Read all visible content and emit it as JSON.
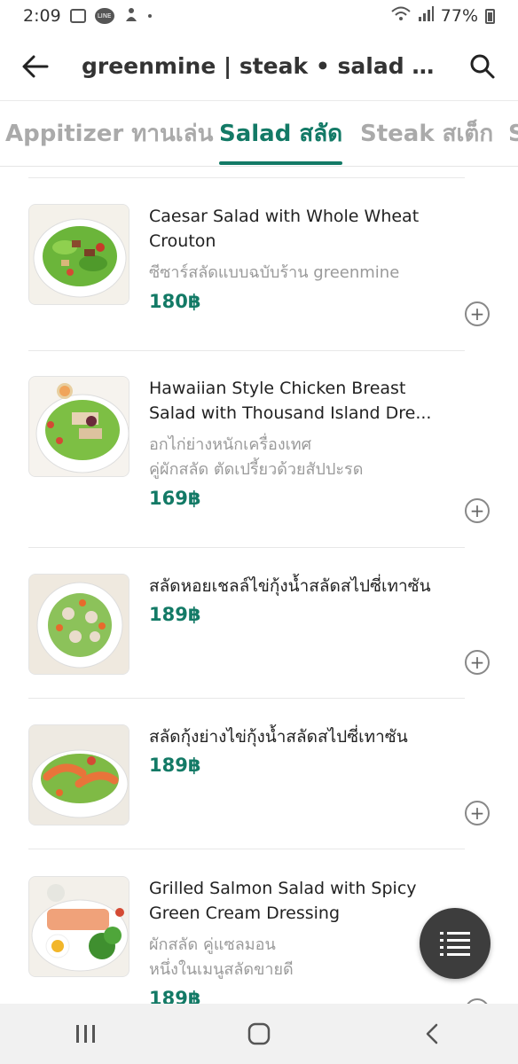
{
  "status_bar": {
    "time": "2:09",
    "battery_text": "77%",
    "line_badge": "LINE"
  },
  "header": {
    "title": "greenmine | steak • salad • coff…"
  },
  "tabs": [
    {
      "label": "Appitizer ทานเล่น",
      "active": false
    },
    {
      "label": "Salad สลัด",
      "active": true
    },
    {
      "label": "Steak สเต็ก",
      "active": false
    },
    {
      "label": "S",
      "active": false
    }
  ],
  "colors": {
    "accent": "#137a66",
    "fab": "#3d3d3d"
  },
  "menu_items": [
    {
      "name_lines": [
        "Caesar Salad with Whole Wheat",
        "Crouton"
      ],
      "desc_lines": [
        "ซีซาร์สลัดแบบฉบับร้าน greenmine"
      ],
      "price": "180฿",
      "image": "caesar-salad-image"
    },
    {
      "name_lines": [
        "Hawaiian Style Chicken Breast",
        "Salad with Thousand Island Dre..."
      ],
      "desc_lines": [
        "อกไก่ย่างหนักเครื่องเทศ",
        "คู่ผักสลัด ตัดเปรี้ยวด้วยสัปปะรด"
      ],
      "price": "169฿",
      "image": "chicken-salad-image"
    },
    {
      "name_lines": [
        "สลัดหอยเชลล์ไข่กุ้งน้ำสลัดสไปซี่เทาซัน"
      ],
      "desc_lines": [],
      "price": "189฿",
      "image": "scallop-salad-image"
    },
    {
      "name_lines": [
        "สลัดกุ้งย่างไข่กุ้งน้ำสลัดสไปซี่เทาซัน"
      ],
      "desc_lines": [],
      "price": "189฿",
      "image": "shrimp-salad-image"
    },
    {
      "name_lines": [
        "Grilled Salmon Salad with Spicy",
        "Green Cream Dressing"
      ],
      "desc_lines": [
        "ผักสลัด คู่แซลมอน",
        "หนึ่งในเมนูสลัดขายดี"
      ],
      "price": "189฿",
      "image": "salmon-salad-image"
    }
  ],
  "icons": {
    "back": "back-arrow-icon",
    "search": "search-icon",
    "add": "plus-circle-icon",
    "fab": "menu-list-icon",
    "nav_recent": "recent-apps-icon",
    "nav_home": "home-icon",
    "nav_back": "nav-back-icon"
  }
}
